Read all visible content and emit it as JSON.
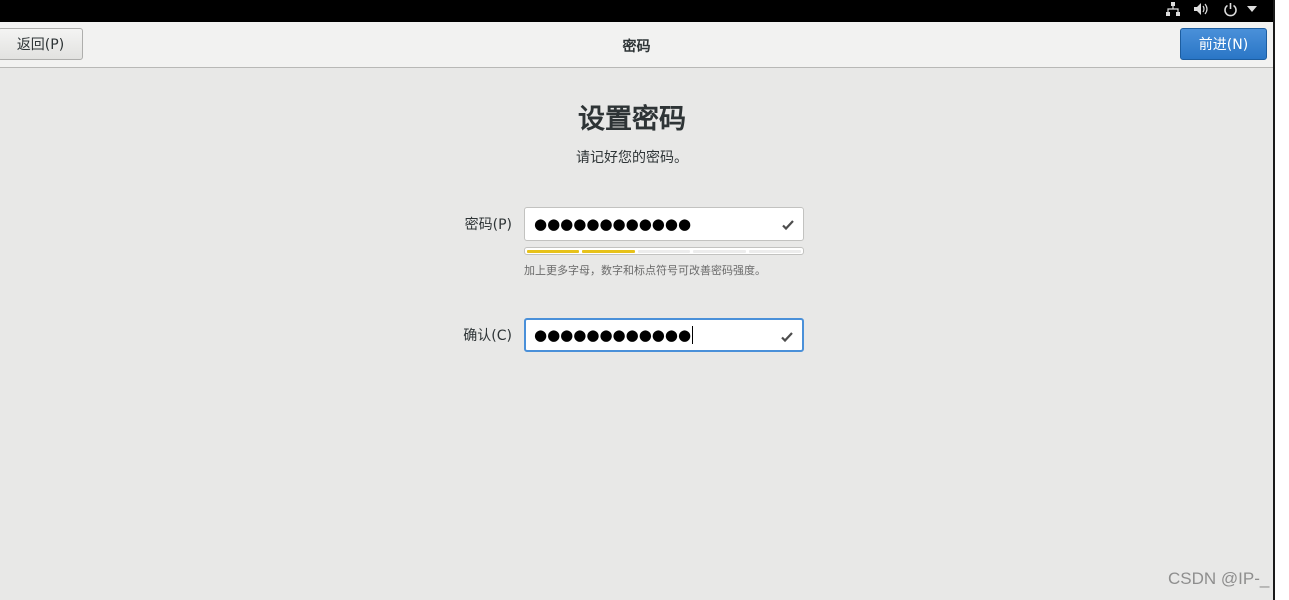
{
  "header": {
    "back_label": "返回(P)",
    "title": "密码",
    "next_label": "前进(N)"
  },
  "page": {
    "title": "设置密码",
    "subtitle": "请记好您的密码。"
  },
  "password": {
    "label": "密码(P)",
    "masked_value": "●●●●●●●●●●●●",
    "strength_segments_total": 5,
    "strength_segments_filled": 2,
    "strength_color": "#e7c21a",
    "hint": "加上更多字母，数字和标点符号可改善密码强度。"
  },
  "confirm": {
    "label": "确认(C)",
    "masked_value": "●●●●●●●●●●●●"
  },
  "tray": {
    "icons": [
      "network-icon",
      "volume-icon",
      "power-icon",
      "menu-arrow-icon"
    ]
  },
  "watermark": "CSDN @IP-_",
  "colors": {
    "accent": "#4a90d9",
    "background": "#e8e8e7"
  }
}
